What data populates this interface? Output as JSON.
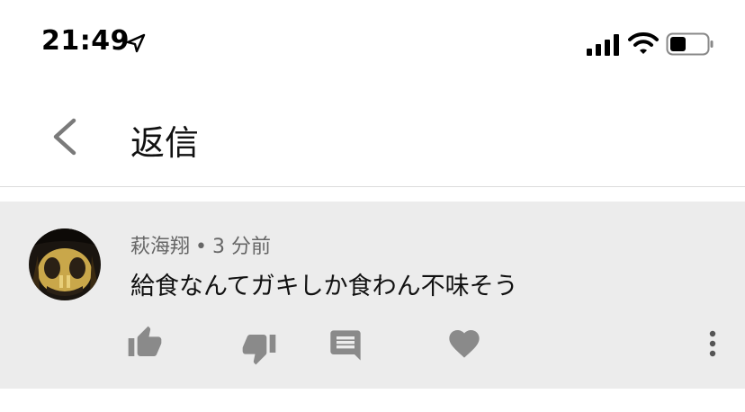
{
  "status_bar": {
    "time": "21:49",
    "icons": [
      "location-arrow-icon",
      "signal-icon",
      "wifi-icon",
      "battery-icon"
    ]
  },
  "header": {
    "back_icon": "chevron-left-icon",
    "title": "返信"
  },
  "comment": {
    "author": "萩海翔",
    "separator": "•",
    "time_ago": "3 分前",
    "text": "給食なんてガキしか食わん不味そう",
    "actions": [
      "thumbs-up-icon",
      "thumbs-down-icon",
      "reply-icon",
      "heart-icon",
      "more-vert-icon"
    ]
  },
  "colors": {
    "card_background": "#ececec",
    "icon_gray": "#8a8a8a",
    "meta_text": "#666666"
  }
}
